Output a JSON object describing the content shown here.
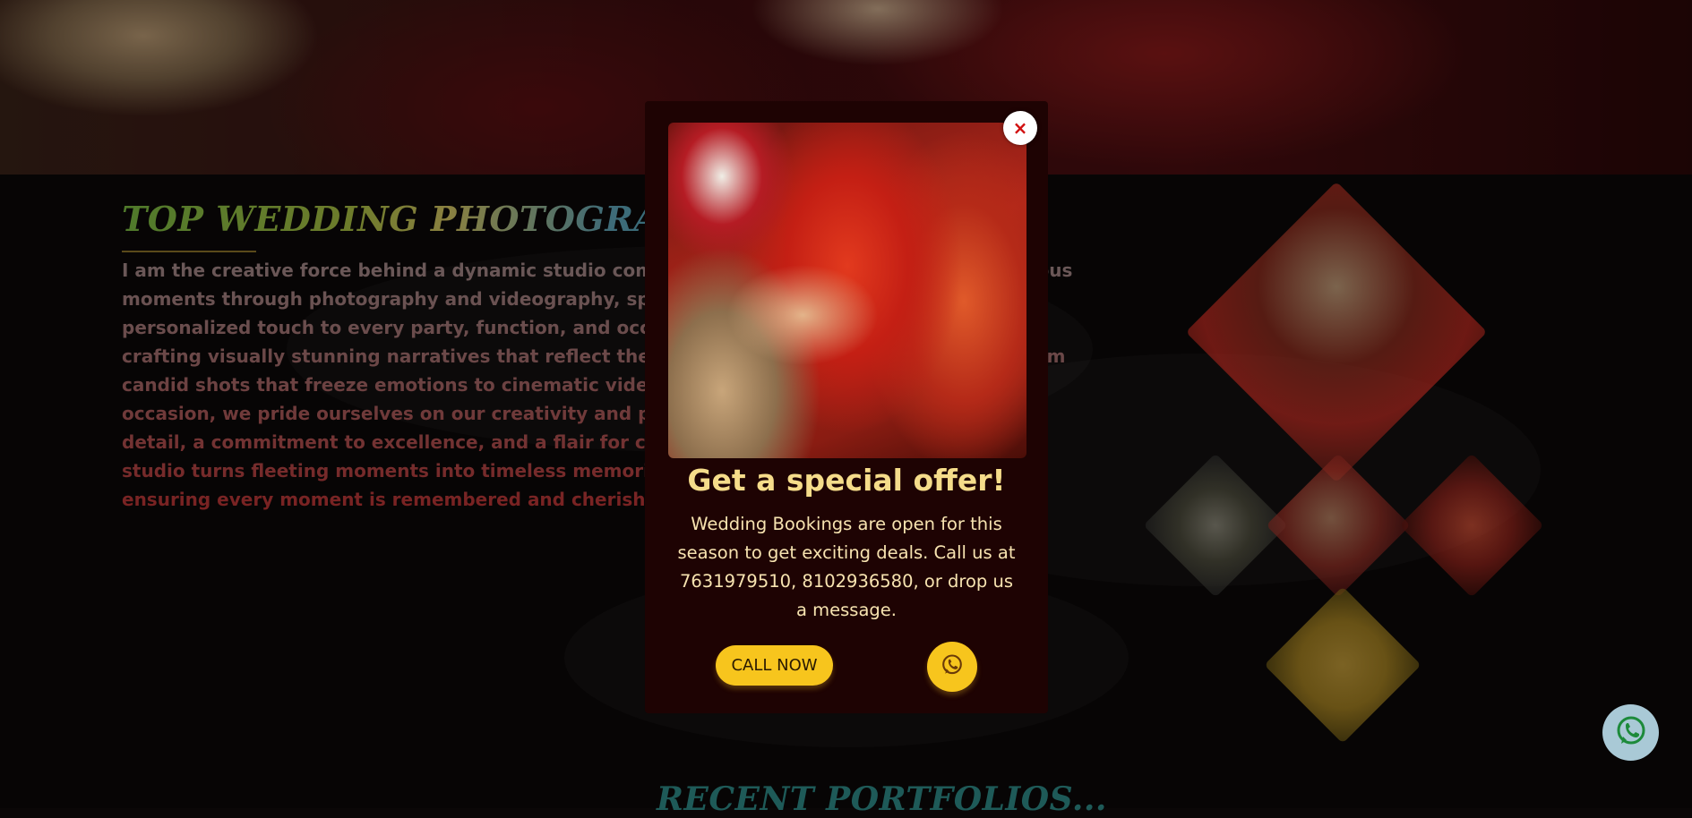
{
  "background": {
    "about_title": "TOP WEDDING PHOTOGRAPHER",
    "about_text": "I am the creative force behind a dynamic studio company, dedicated to capturing life's joyous moments through photography and videography, specializing in bringing a unique and personalized touch to every party, function, and occasion. My talented team and I excel in crafting visually stunning narratives that reflect the essence and beauty of each event. From candid shots that freeze emotions to cinematic videos that encapsulate the vibrancy of the occasion, we pride ourselves on our creativity and professionalism. With an acute eye for detail, a commitment to excellence, and a flair for capturing the magic in every frame, our studio turns fleeting moments into timeless memories. Let us be your visual storytellers, ensuring every moment is remembered and cherished for a lifetime.",
    "portfolio_title": "RECENT PORTFOLIOS..."
  },
  "modal": {
    "close_symbol": "×",
    "title": "Get a special offer!",
    "text": "Wedding Bookings are open for this season to get exciting deals. Call us at 7631979510, 8102936580, or drop us a message.",
    "call_button_label": "CALL NOW",
    "whatsapp_icon": "whatsapp-icon"
  },
  "floating": {
    "whatsapp_icon": "whatsapp-icon"
  },
  "colors": {
    "accent_yellow": "#f7c51d",
    "modal_bg": "#1e0303",
    "title_color": "#f5dc8a",
    "close_x": "#d10f0f",
    "whatsapp_green": "#1c8a3a"
  }
}
